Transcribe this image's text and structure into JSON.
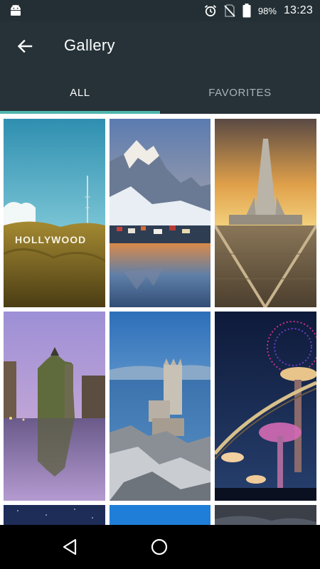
{
  "status_bar": {
    "left_icon": "android-icon",
    "alarm_icon": "alarm-icon",
    "signal_icon": "no-sim-icon",
    "battery_icon": "battery-icon",
    "battery_percent": "98%",
    "time": "13:23"
  },
  "app_bar": {
    "back_icon": "arrow-back-icon",
    "title": "Gallery"
  },
  "tabs": [
    {
      "label": "ALL",
      "selected": true
    },
    {
      "label": "FAVORITES",
      "selected": false
    }
  ],
  "colors": {
    "status_bar": "#232f34",
    "app_bar": "#263238",
    "tab_indicator": "#4db6ac",
    "nav_bar": "#000000"
  },
  "gallery": {
    "items": [
      {
        "subject": "Hollywood sign",
        "sign_text": "HOLLYWOOD"
      },
      {
        "subject": "Snowy mountains with harbour village"
      },
      {
        "subject": "Hallgrimskirkja church at sunset"
      },
      {
        "subject": "Castle on river at dusk"
      },
      {
        "subject": "Swallow's Nest castle on cliff"
      },
      {
        "subject": "Supertree Grove at night"
      },
      {
        "subject": "Night sky (partial)"
      },
      {
        "subject": "Blue sky (partial)"
      },
      {
        "subject": "Dark clouds (partial)"
      }
    ]
  },
  "nav_bar": {
    "back_icon": "nav-back-triangle-icon",
    "home_icon": "nav-home-circle-icon"
  }
}
